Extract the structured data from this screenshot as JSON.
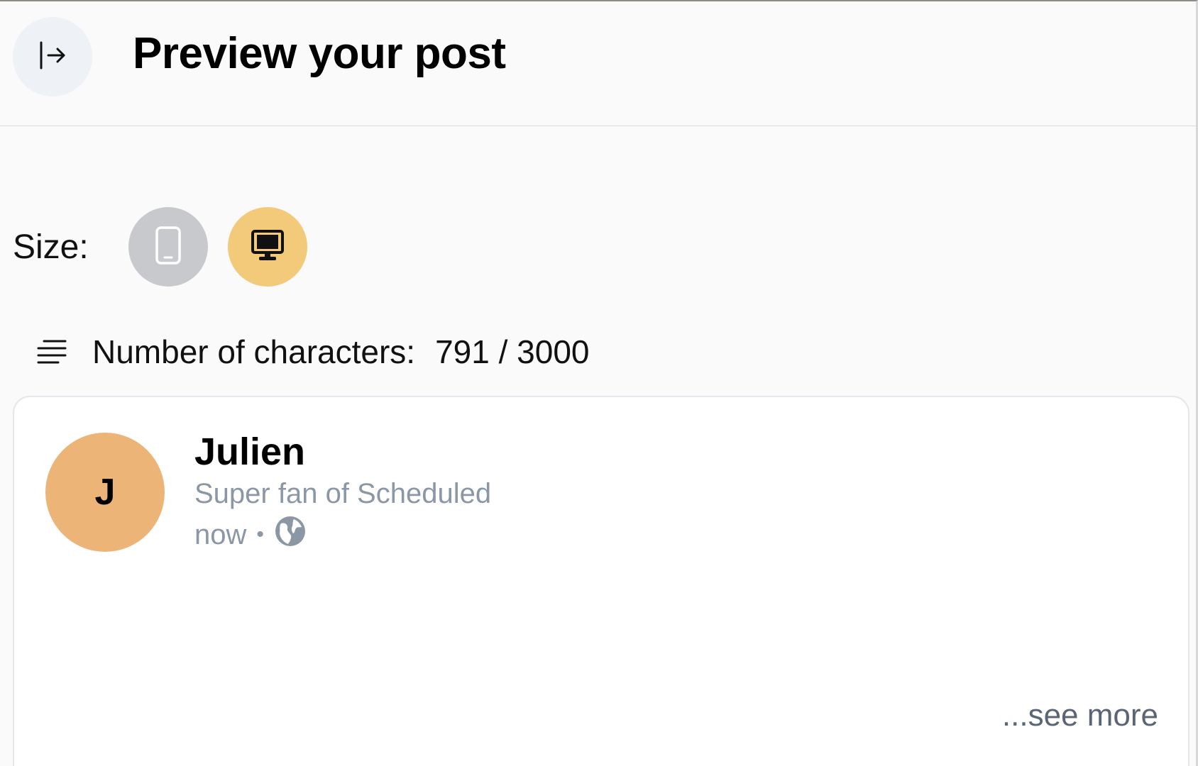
{
  "header": {
    "title": "Preview your post",
    "collapse_icon": "collapse-panel-icon"
  },
  "size": {
    "label": "Size:",
    "options": [
      {
        "name": "mobile",
        "icon": "mobile-phone-icon",
        "selected": false,
        "color": "#c8c9cc"
      },
      {
        "name": "desktop",
        "icon": "desktop-monitor-icon",
        "selected": true,
        "color": "#f3c97a"
      }
    ]
  },
  "characters": {
    "label": "Number of characters:",
    "count": "791 / 3000",
    "current": 791,
    "max": 3000,
    "icon": "text-lines-icon"
  },
  "post": {
    "avatar_initial": "J",
    "avatar_color": "#ecb577",
    "author_name": "Julien",
    "author_headline": "Super fan of Scheduled",
    "time": "now",
    "separator": "•",
    "visibility_icon": "globe-icon",
    "see_more": "...see more"
  }
}
